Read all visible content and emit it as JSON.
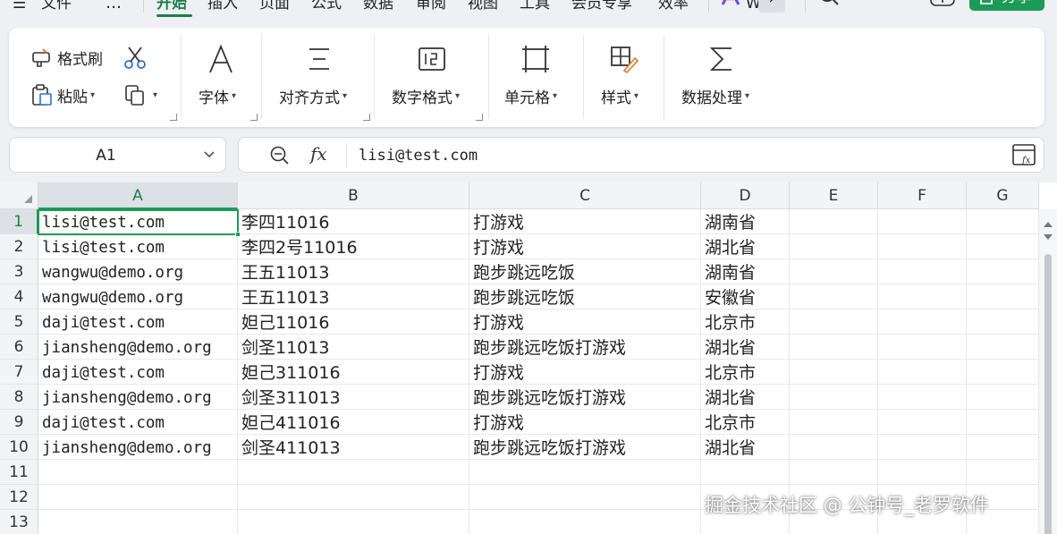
{
  "menu": {
    "items": [
      "文件",
      "开始",
      "插入",
      "页面",
      "公式",
      "数据",
      "审阅",
      "视图",
      "工具",
      "会员专享",
      "效率"
    ],
    "ai_label": "W",
    "more_glyph": "…",
    "share_label": "分享"
  },
  "ribbon": {
    "format_painter": "格式刷",
    "paste": "粘贴",
    "font": "字体",
    "align": "对齐方式",
    "number_format": "数字格式",
    "cell": "单元格",
    "style": "样式",
    "data_process": "数据处理"
  },
  "formula_bar": {
    "name_box": "A1",
    "fx": "fx",
    "value": "lisi@test.com"
  },
  "grid": {
    "columns": [
      "A",
      "B",
      "C",
      "D",
      "E",
      "F",
      "G"
    ],
    "rows": [
      "1",
      "2",
      "3",
      "4",
      "5",
      "6",
      "7",
      "8",
      "9",
      "10",
      "11",
      "12",
      "13"
    ],
    "data": [
      [
        "lisi@test.com",
        "李四11016",
        "打游戏",
        "湖南省"
      ],
      [
        "lisi@test.com",
        "李四2号11016",
        "打游戏",
        "湖北省"
      ],
      [
        "wangwu@demo.org",
        "王五11013",
        "跑步跳远吃饭",
        "湖南省"
      ],
      [
        "wangwu@demo.org",
        "王五11013",
        "跑步跳远吃饭",
        "安徽省"
      ],
      [
        "daji@test.com",
        "妲己11016",
        "打游戏",
        "北京市"
      ],
      [
        "jiansheng@demo.org",
        "剑圣11013",
        "跑步跳远吃饭打游戏",
        "湖北省"
      ],
      [
        "daji@test.com",
        "妲己311016",
        "打游戏",
        "北京市"
      ],
      [
        "jiansheng@demo.org",
        "剑圣311013",
        "跑步跳远吃饭打游戏",
        "湖北省"
      ],
      [
        "daji@test.com",
        "妲己411016",
        "打游戏",
        "北京市"
      ],
      [
        "jiansheng@demo.org",
        "剑圣411013",
        "跑步跳远吃饭打游戏",
        "湖北省"
      ]
    ],
    "selected_cell": "A1"
  },
  "watermark": "掘金技术社区 @ 公钟号_老罗软件",
  "colors": {
    "accent": "#1a9b57",
    "accent_text": "#1a7f4b",
    "header_bg": "#f3f4f6"
  }
}
